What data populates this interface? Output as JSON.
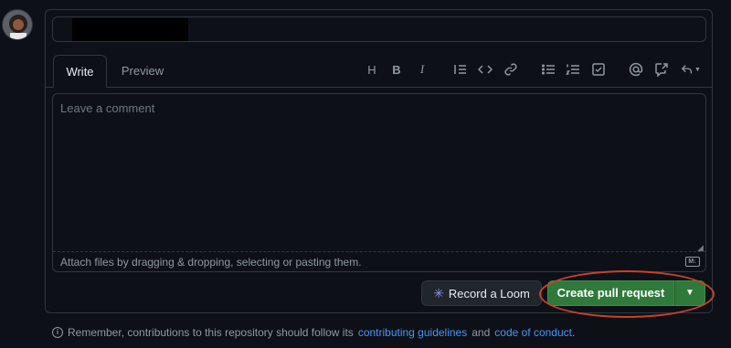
{
  "title_input": {
    "value": ""
  },
  "tabs": {
    "write": "Write",
    "preview": "Preview"
  },
  "toolbar": {
    "heading": "H",
    "bold": "B",
    "italic": "I"
  },
  "editor": {
    "placeholder": "Leave a comment",
    "attach_hint": "Attach files by dragging & dropping, selecting or pasting them.",
    "markdown_badge": "M↓"
  },
  "actions": {
    "loom_label": "Record a Loom",
    "create_label": "Create pull request"
  },
  "footer": {
    "prefix": "Remember, contributions to this repository should follow its",
    "guidelines_link": "contributing guidelines",
    "and": "and",
    "conduct_link": "code of conduct",
    "suffix": "."
  },
  "colors": {
    "primary_button": "#2f7a3a",
    "link": "#4493f8",
    "annotation": "#c9412a"
  }
}
